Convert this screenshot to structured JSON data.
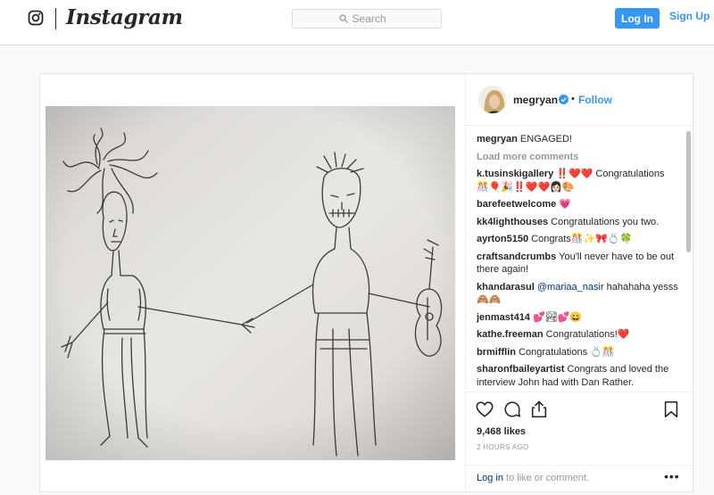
{
  "nav": {
    "brand": "Instagram",
    "search_placeholder": "Search",
    "login_label": "Log In",
    "signup_label": "Sign Up"
  },
  "post": {
    "username": "megryan",
    "dot": "•",
    "follow_label": "Follow",
    "caption": "ENGAGED!",
    "load_more": "Load more comments",
    "comments": [
      {
        "user": "k.tusinskigallery",
        "text": "‼️❤️❤️ Congratulations 🎊🎈🎉‼️❤️❤️👩🏻🎨"
      },
      {
        "user": "barefeetwelcome",
        "text": "💗"
      },
      {
        "user": "kk4lighthouses",
        "text": "Congratulations you two."
      },
      {
        "user": "ayrton5150",
        "text": "Congrats🎊✨🎀💍🍀"
      },
      {
        "user": "craftsandcrumbs",
        "text": "You'll never have to be out there again!"
      },
      {
        "user": "khandarasul",
        "mention": "@mariaa_nasir",
        "text": " hahahaha yesss🙈🙈"
      },
      {
        "user": "jenmast414",
        "text": "💕🏞💕😄"
      },
      {
        "user": "kathe.freeman",
        "text": "Congratulations!❤️"
      },
      {
        "user": "brmifflin",
        "text": "Congratulations 💍🎊"
      },
      {
        "user": "sharonfbaileyartist",
        "text": "Congrats and loved the interview John had with Dan Rather."
      }
    ],
    "likes": "9,468 likes",
    "time": "2 HOURS AGO",
    "login_link": "Log in",
    "login_suffix": " to like or comment.",
    "more_label": "•••"
  }
}
